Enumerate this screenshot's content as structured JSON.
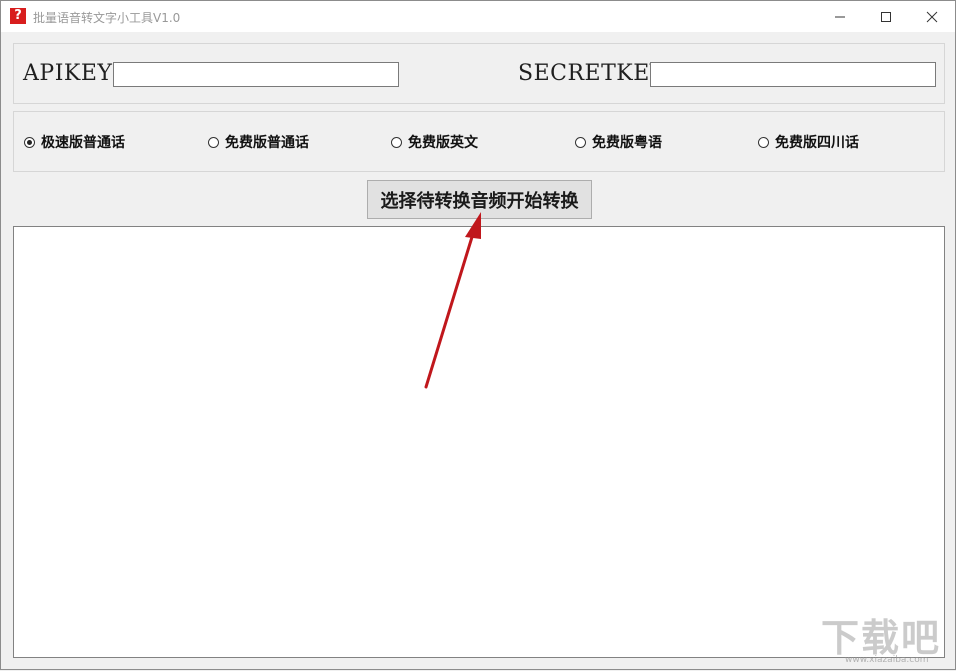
{
  "window": {
    "title": "批量语音转文字小工具V1.0",
    "app_icon_glyph": "?",
    "colors": {
      "app_icon": "#d81e1e",
      "annotation_arrow": "#c0171c"
    }
  },
  "keys": {
    "api_label": "APIKEY",
    "api_value": "",
    "secret_label": "SECRETKEY",
    "secret_value": ""
  },
  "modes": {
    "selected": "极速版普通话",
    "options": [
      {
        "label": "极速版普通话",
        "checked": true
      },
      {
        "label": "免费版普通话",
        "checked": false
      },
      {
        "label": "免费版英文",
        "checked": false
      },
      {
        "label": "免费版粤语",
        "checked": false
      },
      {
        "label": "免费版四川话",
        "checked": false
      }
    ]
  },
  "convert_button": {
    "label": "选择待转换音频开始转换"
  },
  "output": {
    "value": ""
  },
  "watermark": {
    "main": "下载吧",
    "sub": "www.xiazaiba.com"
  }
}
